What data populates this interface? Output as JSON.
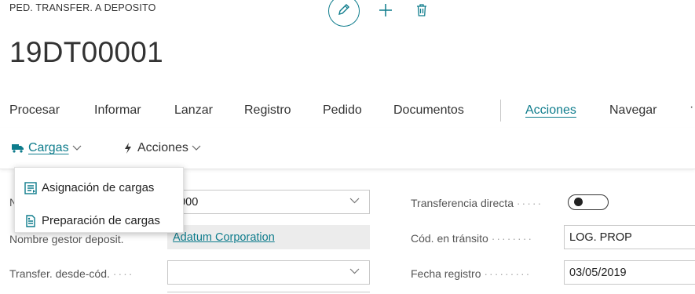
{
  "header": {
    "caption": "PED. TRANSFER. A DEPOSITO",
    "title": "19DT00001",
    "icons": [
      "edit-icon",
      "plus-icon",
      "trash-icon"
    ],
    "accent_color": "#0e7c8c"
  },
  "menu": {
    "items": [
      {
        "label": "Procesar"
      },
      {
        "label": "Informar"
      },
      {
        "label": "Lanzar"
      },
      {
        "label": "Registro"
      },
      {
        "label": "Pedido"
      },
      {
        "label": "Documentos"
      },
      {
        "label": "Acciones",
        "active": true
      },
      {
        "label": "Navegar"
      }
    ]
  },
  "subbar": {
    "cargas_label": "Cargas",
    "acciones_label": "Acciones"
  },
  "dropdown": {
    "items": [
      {
        "label": "Asignación de cargas",
        "icon": "assign-loads-icon"
      },
      {
        "label": "Preparación de cargas",
        "icon": "prepare-loads-icon"
      }
    ]
  },
  "form": {
    "left": {
      "no_value": "0000",
      "nombre_label": "Nombre gestor deposit.",
      "nombre_value": "Adatum Corporation",
      "transfer_label": "Transfer. desde-cód.",
      "transfer_value": ""
    },
    "right": {
      "directa_label": "Transferencia directa",
      "directa_on": false,
      "transito_label": "Cód. en tránsito",
      "transito_value": "LOG. PROP",
      "fecha_label": "Fecha registro",
      "fecha_value": "03/05/2019"
    }
  }
}
